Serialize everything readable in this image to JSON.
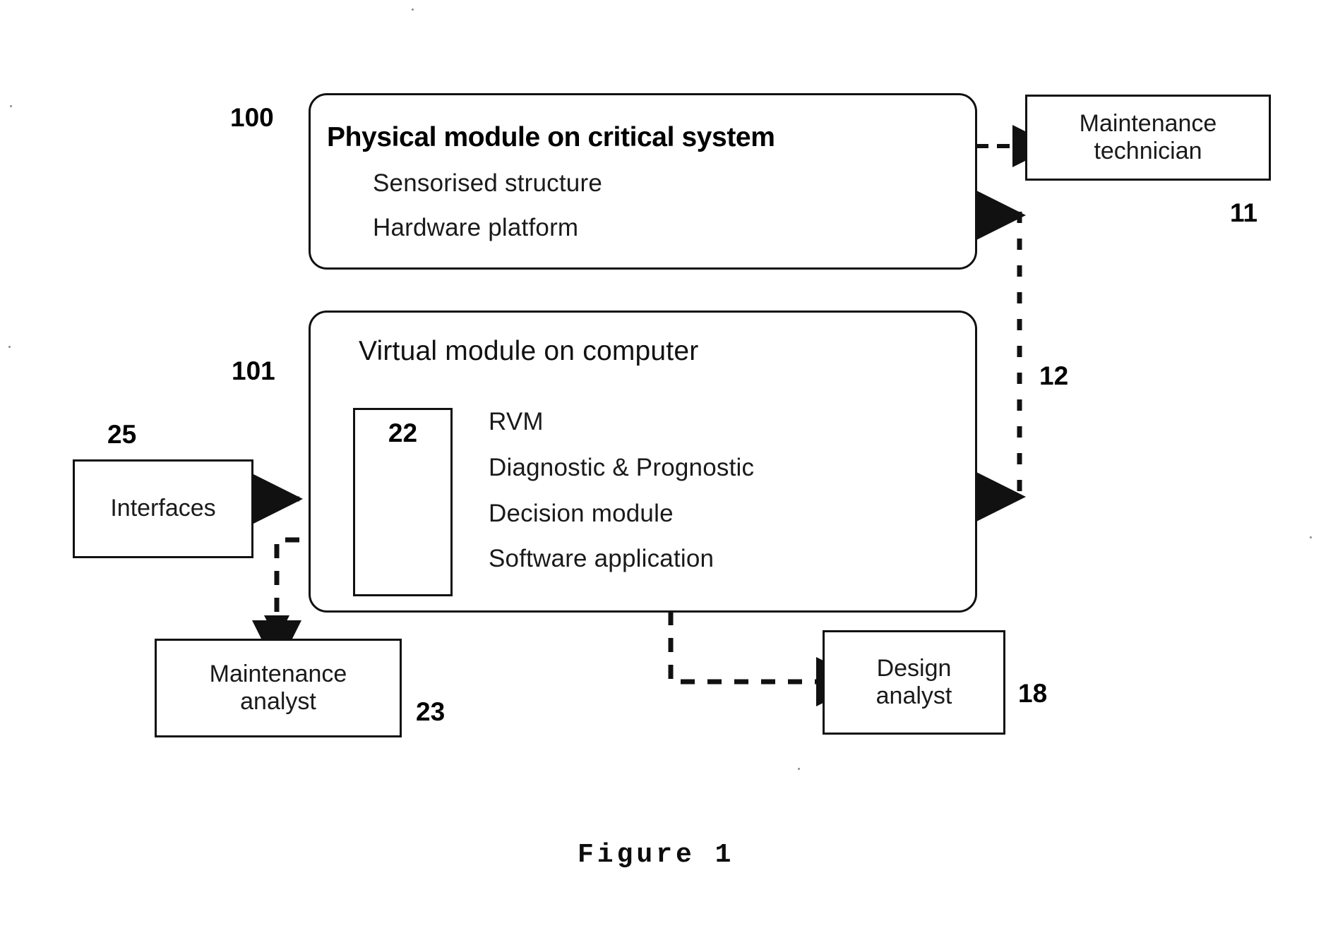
{
  "figure": {
    "caption": "Figure 1"
  },
  "nodes": {
    "physical_module": {
      "ref": "100",
      "title": "Physical module on critical system",
      "lines": [
        "Sensorised structure",
        "Hardware platform"
      ]
    },
    "virtual_module": {
      "ref": "101",
      "title": "Virtual module on computer",
      "lines": [
        "RVM",
        "Diagnostic & Prognostic",
        "Decision module",
        "Software application"
      ],
      "inner_ref": "22"
    },
    "maintenance_technician": {
      "ref": "11",
      "line1": "Maintenance",
      "line2": "technician"
    },
    "interfaces": {
      "ref": "25",
      "label": "Interfaces"
    },
    "maintenance_analyst": {
      "ref": "23",
      "line1": "Maintenance",
      "line2": "analyst"
    },
    "design_analyst": {
      "ref": "18",
      "line1": "Design",
      "line2": "analyst"
    }
  },
  "connectors": {
    "feedback_link": {
      "ref": "12"
    }
  },
  "colors": {
    "ink": "#111111",
    "background": "#ffffff"
  }
}
